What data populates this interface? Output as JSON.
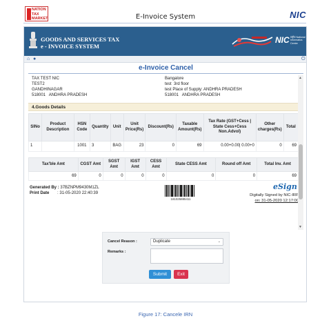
{
  "doc": {
    "nation_logo": "NATION TAX MARKET",
    "title": "E-Invoice System",
    "nic_logo": "NIC",
    "caption": "Figure 17: Cancele IRN"
  },
  "app": {
    "banner_line1": "GOODS AND SERVICES TAX",
    "banner_line2": "e - INVOICE SYSTEM",
    "nic": "NIC",
    "nic_sub": "राष्ट्रीय National Informatics Centre",
    "heading": "e-Invoice Cancel"
  },
  "address": {
    "left": "TAX TEST NIC\nTEST2\nGANDHINAGAR\n518001   ANDHRA PRADESH",
    "right": "Bangalore\ntest  3rd floor\ntest Place of Supply: ANDHRA PRADESH\n518001   ANDHRA PRADESH"
  },
  "goods": {
    "section_title": "4.Goods Details",
    "headers": [
      "SlNo",
      "Product Description",
      "HSN Code",
      "Quantity",
      "Unit",
      "Unit Price(Rs)",
      "Discount(Rs)",
      "Taxable Amount(Rs)",
      "Tax Rate (GST+Cess | State Cess+Cess Non.Advol)",
      "Other charges(Rs)",
      "Total"
    ],
    "rows": [
      [
        "1",
        "",
        "1001",
        "3",
        "BAG",
        "23",
        "0",
        "69",
        "0.00+0.00| 0.00+0",
        "0",
        "69"
      ]
    ]
  },
  "totals": {
    "headers": [
      "Tax'ble Amt",
      "CGST Amt",
      "SGST Amt",
      "IGST Amt",
      "CESS Amt",
      "State CESS Amt",
      "Round off Amt",
      "Total Inv. Amt"
    ],
    "values": [
      "69",
      "0",
      "0",
      "0",
      "0",
      "0",
      "0",
      "69"
    ]
  },
  "meta": {
    "generated_by_label": "Generated By :",
    "generated_by": "37BZNPM9430M1ZL",
    "print_date_label": "Print Date",
    "print_date": "31-05-2020 22:40:39",
    "barcode_number": "181025885411",
    "esign": "eSign",
    "signed_line1": "Digitally Signed by NIC-IRP",
    "signed_line2": "on: 31-05-2020 12:17:00"
  },
  "form": {
    "reason_label": "Cancel Reason :",
    "reason_value": "Duplicate",
    "remarks_label": "Remarks :",
    "remarks_value": "",
    "submit": "Submit",
    "exit": "Exit"
  },
  "colors": {
    "banner": "#2b5f8e",
    "heading": "#2d5fa8",
    "submit": "#2f8fd6",
    "exit": "#d9344f"
  },
  "icons": [
    "home-icon",
    "user-icon",
    "power-icon"
  ]
}
